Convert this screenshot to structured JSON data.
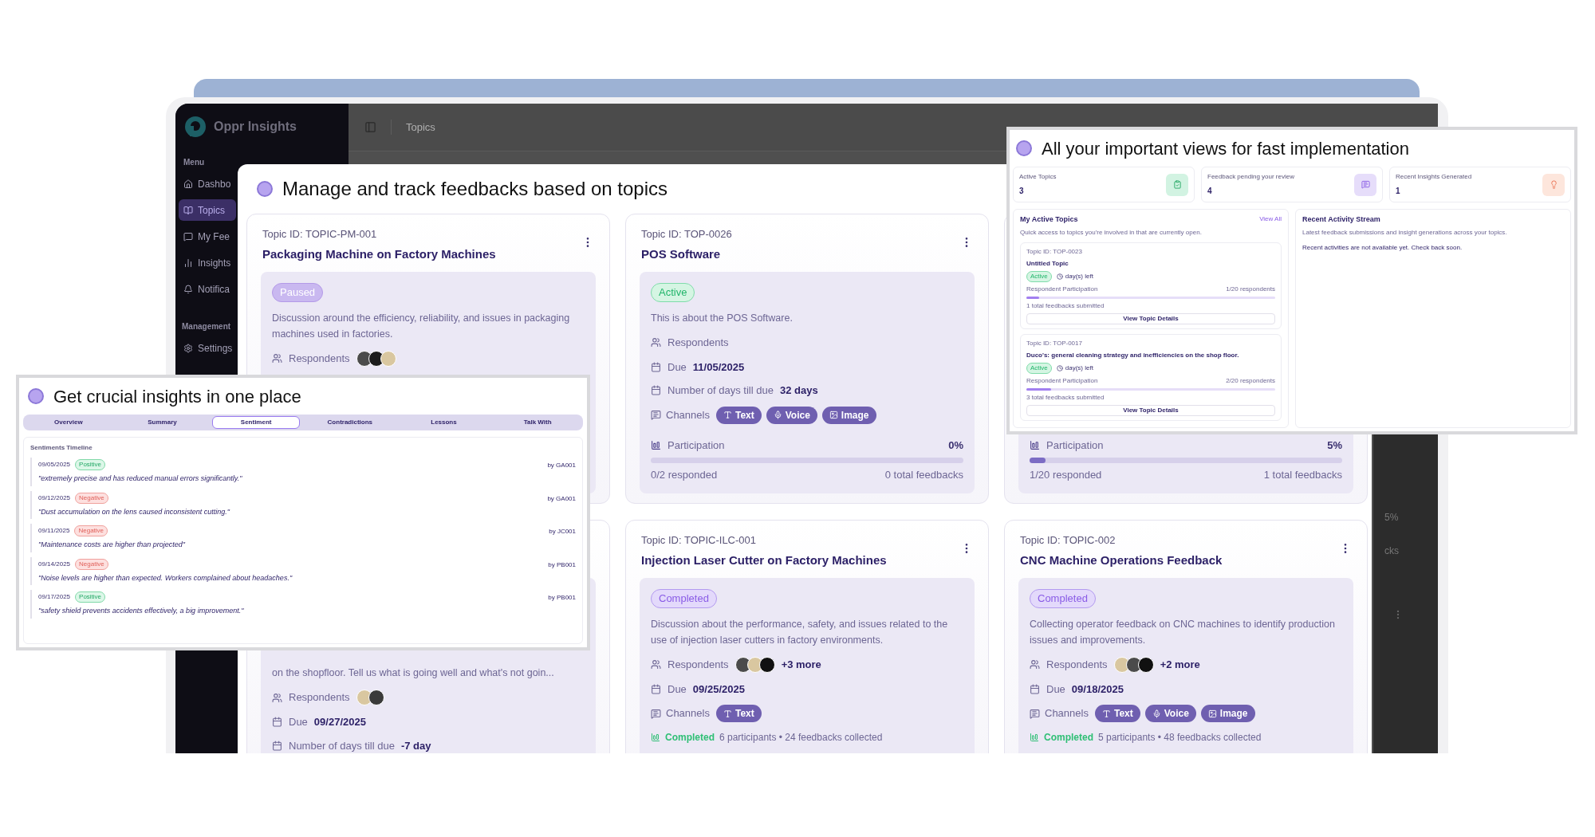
{
  "app": {
    "brand": "Oppr Insights",
    "menu_heading": "Menu",
    "menu": [
      {
        "label": "Dashbo",
        "selected": false
      },
      {
        "label": "Topics",
        "selected": true
      },
      {
        "label": "My Fee",
        "selected": false
      },
      {
        "label": "Insights",
        "selected": false
      },
      {
        "label": "Notifica",
        "selected": false
      }
    ],
    "management_heading": "Management",
    "management": [
      {
        "label": "Settings",
        "selected": false
      }
    ],
    "breadcrumb": "Topics",
    "fragments": [
      "5%",
      "cks"
    ]
  },
  "topics_panel": {
    "title": "Manage and track feedbacks based on topics",
    "cards": [
      {
        "topic_id": "Topic ID: TOPIC-PM-001",
        "title": "Packaging Machine on Factory Machines",
        "status": {
          "label": "Paused",
          "kind": "paused"
        },
        "description": "Discussion around the efficiency, reliability, and issues in packaging machines used in factories.",
        "respondents": {
          "label": "Respondents",
          "avatars": [
            {
              "color": "#4b4b4b"
            },
            {
              "color": "#1c1c1c"
            },
            {
              "color": "#d9c7a0"
            }
          ]
        }
      },
      {
        "topic_id": "Topic ID: TOP-0026",
        "title": "POS Software",
        "status": {
          "label": "Active",
          "kind": "active"
        },
        "description": "This is about the POS Software.",
        "respondents": {
          "label": "Respondents"
        },
        "due": {
          "label": "Due",
          "value": "11/05/2025"
        },
        "days": {
          "label": "Number of days till due",
          "value": "32 days"
        },
        "channels": {
          "label": "Channels",
          "items": [
            {
              "label": "Text",
              "kind": "text"
            },
            {
              "label": "Voice",
              "kind": "voice"
            },
            {
              "label": "Image",
              "kind": "image"
            }
          ]
        },
        "participation": {
          "label": "Participation",
          "value": "0%",
          "level": 0,
          "responded": "0/2 responded",
          "total": "0 total feedbacks"
        }
      },
      {
        "participation": {
          "label": "Participation",
          "value": "5%",
          "level": 0.05,
          "responded": "1/20 responded",
          "total": "1 total feedbacks"
        }
      },
      {
        "description": "on the shopfloor. Tell us what is going well and what's not goin...",
        "respondents": {
          "label": "Respondents",
          "avatars": [
            {
              "color": "#d9c7a0"
            },
            {
              "color": "#3a3a3a"
            }
          ]
        },
        "due": {
          "label": "Due",
          "value": "09/27/2025"
        },
        "days": {
          "label": "Number of days till due",
          "value": "-7 day"
        }
      },
      {
        "topic_id": "Topic ID: TOPIC-ILC-001",
        "title": "Injection Laser Cutter on Factory Machines",
        "status": {
          "label": "Completed",
          "kind": "completed"
        },
        "description": "Discussion about the performance, safety, and issues related to the use of injection laser cutters in factory environments.",
        "respondents": {
          "label": "Respondents",
          "avatars": [
            {
              "color": "#4b4b4b"
            },
            {
              "color": "#d9c7a0"
            },
            {
              "color": "#111111"
            }
          ],
          "more": "+3 more"
        },
        "due": {
          "label": "Due",
          "value": "09/25/2025"
        },
        "channels": {
          "label": "Channels",
          "items": [
            {
              "label": "Text",
              "kind": "text"
            }
          ]
        },
        "completion": {
          "label": "Completed",
          "summary": "6 participants • 24 feedbacks collected"
        }
      },
      {
        "topic_id": "Topic ID: TOPIC-002",
        "title": "CNC Machine Operations Feedback",
        "status": {
          "label": "Completed",
          "kind": "completed"
        },
        "description": "Collecting operator feedback on CNC machines to identify production issues and improvements.",
        "respondents": {
          "label": "Respondents",
          "avatars": [
            {
              "color": "#d9c7a0"
            },
            {
              "color": "#4b4b4b"
            },
            {
              "color": "#111111"
            }
          ],
          "more": "+2 more"
        },
        "due": {
          "label": "Due",
          "value": "09/18/2025"
        },
        "channels": {
          "label": "Channels",
          "items": [
            {
              "label": "Text",
              "kind": "text"
            },
            {
              "label": "Voice",
              "kind": "voice"
            },
            {
              "label": "Image",
              "kind": "image"
            }
          ]
        },
        "completion": {
          "label": "Completed",
          "summary": "5 participants • 48 feedbacks collected"
        }
      }
    ]
  },
  "insights_panel": {
    "title": "Get crucial insights in one place",
    "tabs": [
      {
        "label": "Overview",
        "selected": false
      },
      {
        "label": "Summary",
        "selected": false
      },
      {
        "label": "Sentiment",
        "selected": true
      },
      {
        "label": "Contradictions",
        "selected": false
      },
      {
        "label": "Lessons",
        "selected": false
      },
      {
        "label": "Talk With",
        "selected": false
      }
    ],
    "section_title": "Sentiments Timeline",
    "entries": [
      {
        "date": "09/05/2025",
        "sentiment": {
          "label": "Positive",
          "kind": "positive"
        },
        "author": "by GA001",
        "quote": "\"extremely precise and has reduced manual errors significantly.\""
      },
      {
        "date": "09/12/2025",
        "sentiment": {
          "label": "Negative",
          "kind": "negative"
        },
        "author": "by GA001",
        "quote": "\"Dust accumulation on the lens caused inconsistent cutting.\""
      },
      {
        "date": "09/11/2025",
        "sentiment": {
          "label": "Negative",
          "kind": "negative"
        },
        "author": "by JC001",
        "quote": "\"Maintenance costs are higher than projected\""
      },
      {
        "date": "09/14/2025",
        "sentiment": {
          "label": "Negative",
          "kind": "negative"
        },
        "author": "by PB001",
        "quote": "\"Noise levels are higher than expected. Workers complained about headaches.\""
      },
      {
        "date": "09/17/2025",
        "sentiment": {
          "label": "Positive",
          "kind": "positive"
        },
        "author": "by PB001",
        "quote": "\"safety shield prevents accidents effectively, a big improvement.\""
      }
    ]
  },
  "views_panel": {
    "title": "All your important views for fast implementation",
    "stats": [
      {
        "label": "Active Topics",
        "value": "3",
        "kind": "topics"
      },
      {
        "label": "Feedback pending your review",
        "value": "4",
        "kind": "feedback"
      },
      {
        "label": "Recent Insights Generated",
        "value": "1",
        "kind": "insights"
      }
    ],
    "active_topics": {
      "title": "My Active Topics",
      "subtitle": "Quick access to topics you're involved in that are currently open.",
      "link": "View All",
      "items": [
        {
          "topic_id": "Topic ID: TOP-0023",
          "title": "Untitled Topic",
          "status": "Active",
          "time_left": "day(s) left",
          "participation_label": "Respondent Participation",
          "respondents": "1/20 respondents",
          "level": 0.05,
          "submitted": "1 total feedbacks submitted",
          "button": "View Topic Details"
        },
        {
          "topic_id": "Topic ID: TOP-0017",
          "title": "Duco's: general cleaning strategy and inefficiencies on the shop floor.",
          "status": "Active",
          "time_left": "day(s) left",
          "participation_label": "Respondent Participation",
          "respondents": "2/20 respondents",
          "level": 0.1,
          "submitted": "3 total feedbacks submitted",
          "button": "View Topic Details"
        }
      ]
    },
    "activity": {
      "title": "Recent Activity Stream",
      "subtitle": "Latest feedback submissions and insight generations across your topics.",
      "empty": "Recent activities are not available yet. Check back soon."
    }
  }
}
